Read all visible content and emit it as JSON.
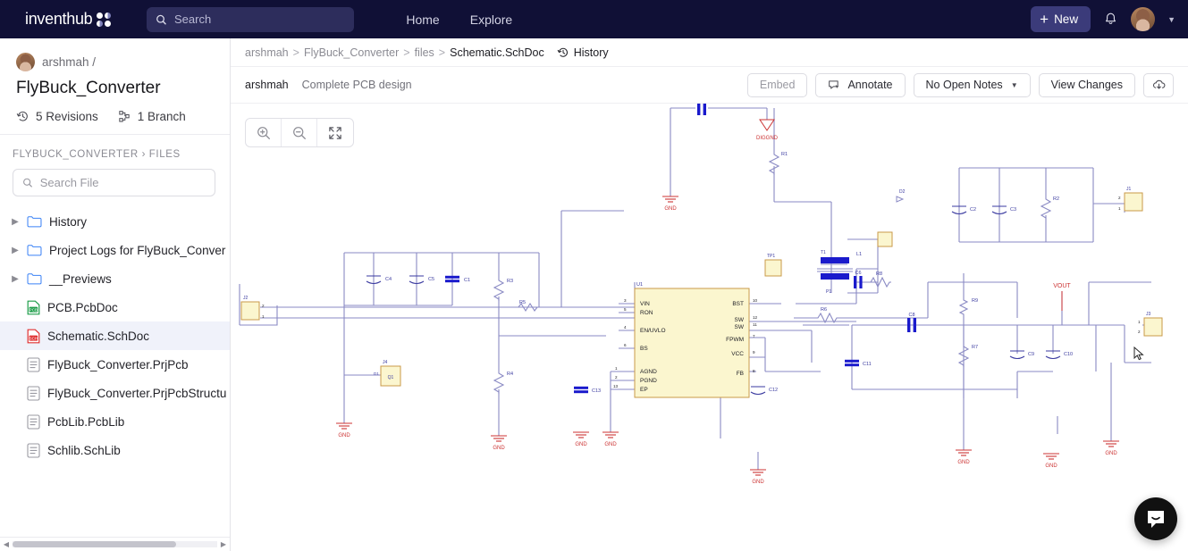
{
  "topnav": {
    "brand": "inventhub",
    "brand_icon": "four-dots-logo",
    "search": {
      "placeholder": "Search",
      "value": "",
      "icon": "search-icon"
    },
    "links": [
      {
        "label": "Home"
      },
      {
        "label": "Explore"
      }
    ],
    "new_button": {
      "label": "New",
      "icon": "plus-icon"
    },
    "notifications_icon": "bell-icon",
    "avatar_icon": "user-avatar",
    "account_caret_icon": "chevron-down-icon",
    "bg_color": "#101036",
    "accent_color": "#3b3b7a"
  },
  "sidebar": {
    "owner": "arshmah /",
    "project_title": "FlyBuck_Converter",
    "revisions": {
      "label": "5 Revisions",
      "icon": "history-icon"
    },
    "branch": {
      "label": "1 Branch",
      "icon": "branch-icon"
    },
    "section_header": "FLYBUCK_CONVERTER › FILES",
    "search_file": {
      "placeholder": "Search File",
      "value": "",
      "icon": "search-icon"
    },
    "files": [
      {
        "name": "History",
        "type": "folder",
        "expandable": true,
        "active": false
      },
      {
        "name": "Project Logs for FlyBuck_Conver",
        "type": "folder",
        "expandable": true,
        "active": false
      },
      {
        "name": "__Previews",
        "type": "folder",
        "expandable": true,
        "active": false
      },
      {
        "name": "PCB.PcbDoc",
        "type": "pcb",
        "expandable": false,
        "active": false
      },
      {
        "name": "Schematic.SchDoc",
        "type": "sch",
        "expandable": false,
        "active": true
      },
      {
        "name": "FlyBuck_Converter.PrjPcb",
        "type": "doc",
        "expandable": false,
        "active": false
      },
      {
        "name": "FlyBuck_Converter.PrjPcbStructu",
        "type": "doc",
        "expandable": false,
        "active": false
      },
      {
        "name": "PcbLib.PcbLib",
        "type": "doc",
        "expandable": false,
        "active": false
      },
      {
        "name": "Schlib.SchLib",
        "type": "doc",
        "expandable": false,
        "active": false
      }
    ],
    "scrollbar": {
      "left_arrow": "◀",
      "right_arrow": "▶"
    }
  },
  "breadcrumb": {
    "items": [
      "arshmah",
      "FlyBuck_Converter",
      "files",
      "Schematic.SchDoc"
    ],
    "separator": ">",
    "history": {
      "label": "History",
      "icon": "history-icon"
    }
  },
  "toolbar": {
    "commit_user": "arshmah",
    "commit_message": "Complete PCB design",
    "embed_label": "Embed",
    "annotate_label": "Annotate",
    "annotate_icon": "comment-cursor-icon",
    "notes_label": "No Open Notes",
    "notes_caret_icon": "chevron-down-icon",
    "view_changes_label": "View Changes",
    "download_icon": "download-cloud-icon"
  },
  "viewer": {
    "zoom_in_icon": "zoom-in-icon",
    "zoom_out_icon": "zoom-out-icon",
    "fit_screen_icon": "expand-arrows-icon",
    "chat_icon": "intercom-chat-icon",
    "cursor_icon": "mouse-cursor"
  },
  "schematic": {
    "title": "Schematic.SchDoc",
    "ic": {
      "designator": "U1",
      "left_pins": [
        {
          "num": "3",
          "name": "VIN"
        },
        {
          "num": "5",
          "name": "RON"
        },
        {
          "num": "4",
          "name": "EN/UVLO"
        },
        {
          "num": "6",
          "name": "BS"
        },
        {
          "num": "1",
          "name": "AGND"
        },
        {
          "num": "2",
          "name": "PGND"
        },
        {
          "num": "13",
          "name": "EP"
        }
      ],
      "right_pins": [
        {
          "num": "10",
          "name": "BST"
        },
        {
          "num": "12",
          "name": "SW"
        },
        {
          "num": "11",
          "name": "SW"
        },
        {
          "num": "7",
          "name": "FPWM"
        },
        {
          "num": "9",
          "name": "VCC"
        },
        {
          "num": "8",
          "name": "FB"
        }
      ]
    },
    "capacitors": [
      "C1",
      "C2",
      "C3",
      "C4",
      "C5",
      "C7",
      "C8",
      "C9",
      "C10",
      "C11",
      "C12",
      "C13"
    ],
    "resistors": [
      "R1",
      "R2",
      "R3",
      "R4",
      "R6",
      "R7",
      "R8",
      "R9"
    ],
    "inductor": "L1",
    "test_point": "TP1",
    "connectors": [
      "J1",
      "J2",
      "J3",
      "J4"
    ],
    "transistor": "Q1",
    "net_labels": [
      "DIGGND",
      "VOUT"
    ],
    "ground_labels": [
      "GND",
      "GND",
      "GND",
      "GND",
      "GND",
      "GND",
      "GND",
      "GND"
    ],
    "pin_numbers_misc": [
      "1",
      "2",
      "1",
      "2",
      "4",
      "3",
      "1",
      "2"
    ]
  },
  "colors": {
    "schematic_wire": "#8a8ac4",
    "schematic_component_fill": "#fbf6cf",
    "schematic_component_stroke": "#c89a4a",
    "schematic_label": "#3a3aa0",
    "schematic_ground": "#cc3333",
    "schematic_cap_blue": "#1a1acc"
  }
}
